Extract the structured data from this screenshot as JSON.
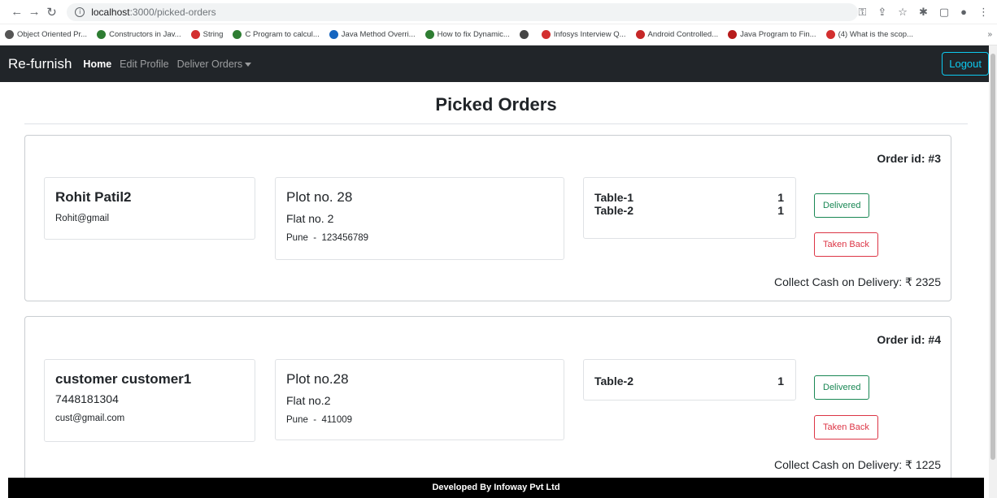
{
  "browser": {
    "url_host": "localhost",
    "url_path": ":3000/picked-orders",
    "bookmarks": [
      {
        "label": "Object Oriented Pr...",
        "color": "#555"
      },
      {
        "label": "Constructors in Jav...",
        "color": "#2e7d32"
      },
      {
        "label": "String",
        "color": "#d32f2f"
      },
      {
        "label": "C Program to calcul...",
        "color": "#2e7d32"
      },
      {
        "label": "Java Method Overri...",
        "color": "#1565c0"
      },
      {
        "label": "How to fix Dynamic...",
        "color": "#2e7d32"
      },
      {
        "label": "",
        "color": "#444"
      },
      {
        "label": "Infosys Interview Q...",
        "color": "#d32f2f"
      },
      {
        "label": "Android Controlled...",
        "color": "#c62828"
      },
      {
        "label": "Java Program to Fin...",
        "color": "#b71c1c"
      },
      {
        "label": "(4) What is the scop...",
        "color": "#d32f2f"
      }
    ],
    "more_label": "»"
  },
  "navbar": {
    "brand": "Re-furnish",
    "links": [
      "Home",
      "Edit Profile",
      "Deliver Orders"
    ],
    "logout": "Logout"
  },
  "page": {
    "title": "Picked Orders"
  },
  "orders": [
    {
      "id_label": "Order id: #3",
      "customer": {
        "name": "Rohit Patil2",
        "phone": "",
        "email": "Rohit@gmail"
      },
      "address": {
        "line1": "Plot no. 28",
        "line2": "Flat no. 2",
        "city": "Pune",
        "sep": "-",
        "pin": "123456789"
      },
      "items": [
        {
          "name": "Table-1",
          "qty": "1"
        },
        {
          "name": "Table-2",
          "qty": "1"
        }
      ],
      "delivered_label": "Delivered",
      "taken_back_label": "Taken Back",
      "collect_label": "Collect Cash on Delivery: ₹ 2325"
    },
    {
      "id_label": "Order id: #4",
      "customer": {
        "name": "customer customer1",
        "phone": "7448181304",
        "email": "cust@gmail.com"
      },
      "address": {
        "line1": "Plot no.28",
        "line2": "Flat no.2",
        "city": "Pune",
        "sep": "-",
        "pin": "411009"
      },
      "items": [
        {
          "name": "Table-2",
          "qty": "1"
        }
      ],
      "delivered_label": "Delivered",
      "taken_back_label": "Taken Back",
      "collect_label": "Collect Cash on Delivery: ₹ 1225"
    }
  ],
  "footer": {
    "text": "Developed By Infoway Pvt Ltd"
  },
  "colors": {
    "navbar": "#212529",
    "logout": "#0dcaf0",
    "success": "#198754",
    "danger": "#dc3545"
  }
}
